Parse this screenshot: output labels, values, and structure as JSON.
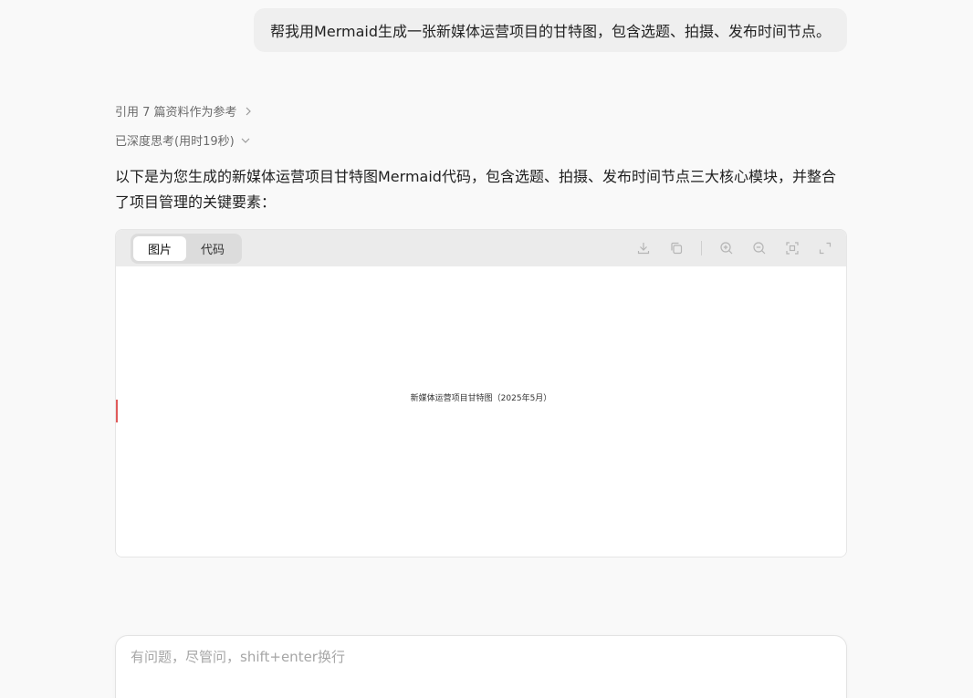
{
  "user_message": "帮我用Mermaid生成一张新媒体运营项目的甘特图，包含选题、拍摄、发布时间节点。",
  "references": {
    "label": "引用 7 篇资料作为参考",
    "icon": "chevron-right-icon"
  },
  "thinking": {
    "label": "已深度思考(用时19秒)",
    "icon": "chevron-down-icon"
  },
  "answer": {
    "intro": "以下是为您生成的新媒体运营项目甘特图Mermaid代码，包含选题、拍摄、发布时间节点三大核心模块，并整合了项目管理的关键要素："
  },
  "diagram_card": {
    "tabs": [
      {
        "label": "图片",
        "active": true
      },
      {
        "label": "代码",
        "active": false
      }
    ],
    "toolbar_icons": [
      "download-icon",
      "copy-icon",
      "zoom-in-icon",
      "zoom-out-icon",
      "fit-view-icon",
      "fullscreen-icon"
    ],
    "diagram_title": "新媒体运营项目甘特图（2025年5月）",
    "today_marker_color": "#e05a5a"
  },
  "composer": {
    "placeholder": "有问题，尽管问，shift+enter换行",
    "value": ""
  }
}
